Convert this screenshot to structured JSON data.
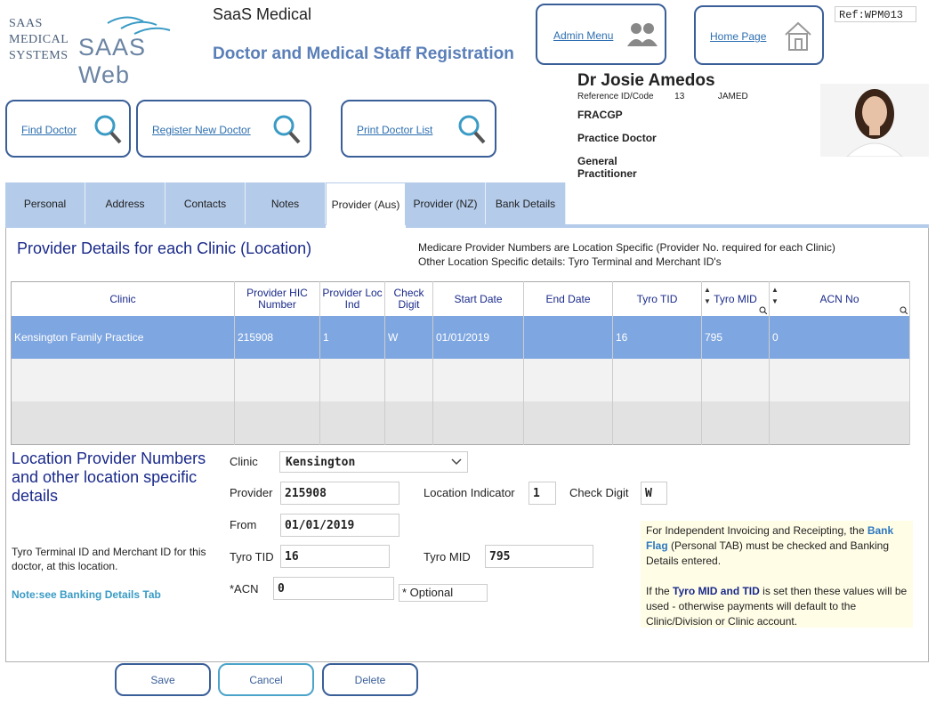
{
  "logo": {
    "line1": "SAAS",
    "line2": "MEDICAL",
    "line3": "SYSTEMS",
    "brand": "SAAS Web"
  },
  "app_name": "SaaS Medical",
  "page_title": "Doctor and Medical Staff Registration",
  "ref_code": "Ref:WPM013",
  "nav": {
    "admin_menu": "Admin Menu",
    "home_page": "Home Page",
    "find_doctor": "Find Doctor",
    "register_new_doctor": "Register New Doctor",
    "print_doctor_list": "Print Doctor List"
  },
  "doctor": {
    "name": "Dr Josie Amedos",
    "ref_label": "Reference ID/Code",
    "ref_id": "13",
    "ref_code": "JAMED",
    "qualification": "FRACGP",
    "role": "Practice Doctor",
    "specialty_line1": "General",
    "specialty_line2": "Practitioner"
  },
  "tabs": [
    {
      "label": "Personal",
      "active": false
    },
    {
      "label": "Address",
      "active": false
    },
    {
      "label": "Contacts",
      "active": false
    },
    {
      "label": "Notes",
      "active": false
    },
    {
      "label": "Provider (Aus)",
      "active": true
    },
    {
      "label": "Provider (NZ)",
      "active": false
    },
    {
      "label": "Bank Details",
      "active": false
    }
  ],
  "section": {
    "title": "Provider Details for each Clinic (Location)",
    "info_line1": "Medicare Provider Numbers are Location Specific (Provider No. required for each Clinic)",
    "info_line2": "Other Location Specific details: Tyro Terminal and Merchant ID's"
  },
  "grid": {
    "headers": [
      "Clinic",
      "Provider HIC Number",
      "Provider Loc Ind",
      "Check Digit",
      "Start Date",
      "End Date",
      "Tyro TID",
      "Tyro MID",
      "ACN No"
    ],
    "rows": [
      [
        "Kensington Family Practice",
        "215908",
        "1",
        "W",
        "01/01/2019",
        "",
        "16",
        "795",
        "0"
      ]
    ]
  },
  "form": {
    "title": "Location Provider Numbers and other location specific details",
    "tyro_note": "Tyro Terminal ID and Merchant ID for this doctor, at this location.",
    "bank_note": "Note:see Banking Details Tab",
    "clinic_label": "Clinic",
    "clinic_value": "Kensington",
    "provider_label": "Provider",
    "provider_value": "215908",
    "location_indicator_label": "Location Indicator",
    "location_indicator_value": "1",
    "check_digit_label": "Check Digit",
    "check_digit_value": "W",
    "from_label": "From",
    "from_value": "01/01/2019",
    "tyro_tid_label": "Tyro TID",
    "tyro_tid_value": "16",
    "tyro_mid_label": "Tyro MID",
    "tyro_mid_value": "795",
    "acn_label": "*ACN",
    "acn_value": "0",
    "optional_label": "* Optional"
  },
  "note": {
    "p1_a": "For Independent Invoicing and Receipting, the ",
    "p1_hl": "Bank Flag",
    "p1_b": " (Personal TAB) must be checked and Banking Details entered.",
    "p2_a": "If the ",
    "p2_hl": "Tyro MID and TID",
    "p2_b": " is set then these values will be used - otherwise payments will default to the Clinic/Division or Clinic account."
  },
  "actions": {
    "save": "Save",
    "cancel": "Cancel",
    "delete": "Delete"
  },
  "colors": {
    "accent": "#3a5f98",
    "tab_bg": "#b4cbea",
    "selected_row": "#7ea6e0",
    "title_blue": "#1a2a8a"
  }
}
